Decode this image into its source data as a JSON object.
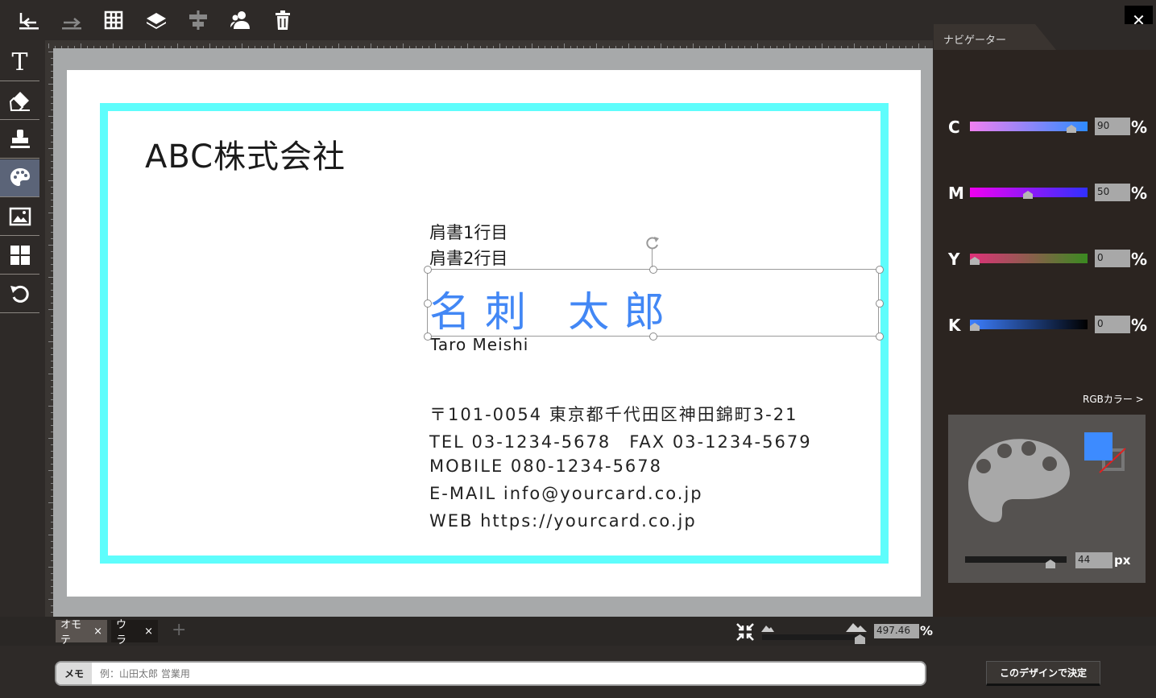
{
  "toolbar": {
    "items": [
      "undo-icon",
      "redo-icon",
      "grid-icon",
      "layers-icon",
      "align-icon",
      "person-icon",
      "trash-icon"
    ],
    "close_label": "✕"
  },
  "left_tools": {
    "items": [
      "text-icon",
      "eraser-icon",
      "stamp-icon",
      "palette-icon",
      "image-icon",
      "layout-icon",
      "reset-icon"
    ],
    "active": "palette-icon"
  },
  "card": {
    "company": "ABC株式会社",
    "title_line1": "肩書1行目",
    "title_line2": "肩書2行目",
    "name": "名刺 太郎",
    "romaji": "Taro Meishi",
    "address": "〒101-0054 東京都千代田区神田錦町3-21",
    "tel_fax": "TEL 03-1234-5678　FAX 03-1234-5679",
    "mobile": "MOBILE 080-1234-5678",
    "email": "E-MAIL info@yourcard.co.jp",
    "web": "WEB https://yourcard.co.jp",
    "frame_color": "#5efdfc",
    "name_color": "#4287f5"
  },
  "panel": {
    "navigator_label": "ナビゲーター",
    "cmyk": [
      {
        "label": "C",
        "value": "90",
        "pct": "%"
      },
      {
        "label": "M",
        "value": "50",
        "pct": "%"
      },
      {
        "label": "Y",
        "value": "0",
        "pct": "%"
      },
      {
        "label": "K",
        "value": "0",
        "pct": "%"
      }
    ],
    "rgb_link": "RGBカラー >",
    "brush_size": "44",
    "brush_unit": "px",
    "fill_color": "#3d8bff"
  },
  "pages": {
    "tabs": [
      {
        "label": "オモテ",
        "close": "×"
      },
      {
        "label": "ウラ",
        "close": "×"
      }
    ],
    "add_label": "+"
  },
  "zoom": {
    "value": "497.46",
    "unit": "%"
  },
  "memo": {
    "label": "メモ",
    "placeholder": "例：山田太郎 営業用"
  },
  "decide_button": "このデザインで決定"
}
